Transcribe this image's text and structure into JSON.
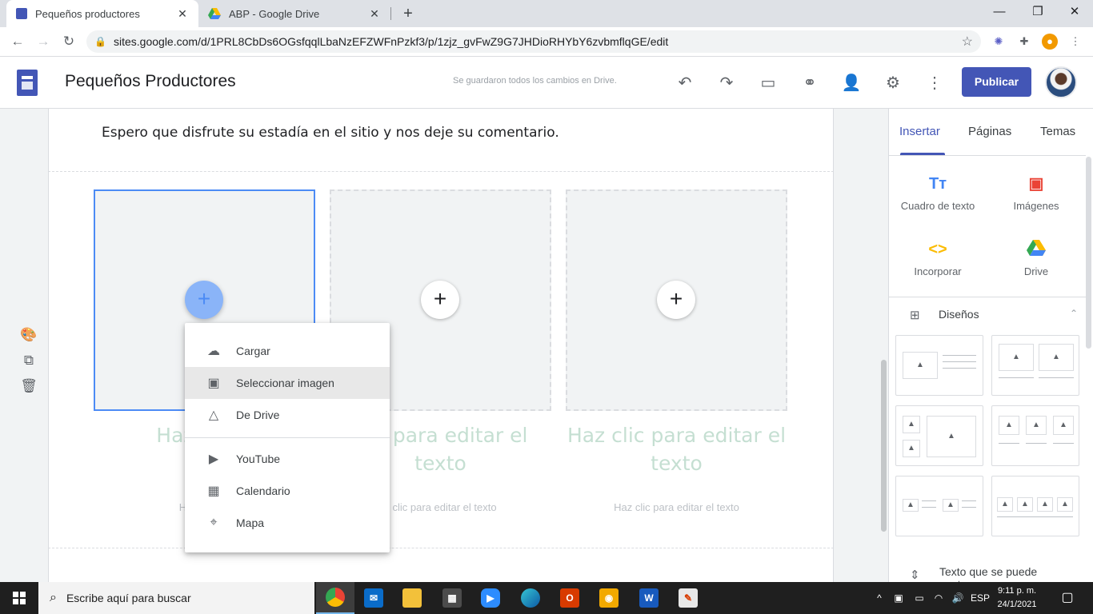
{
  "browser": {
    "tabs": [
      {
        "title": "Pequeños productores",
        "active": true
      },
      {
        "title": "ABP - Google Drive",
        "active": false
      }
    ],
    "url": "sites.google.com/d/1PRL8CbDs6OGsfqqlLbaNzEFZWFnPzkf3/p/1zjz_gvFwZ9G7JHDioRHYbY6zvbmflqGE/edit"
  },
  "header": {
    "site_title": "Pequeños Productores",
    "save_status": "Se guardaron todos los cambios en Drive.",
    "publish_label": "Publicar"
  },
  "page": {
    "intro_text": "Espero que disfrute su estadía en el sitio y nos deje su comentario.",
    "columns": [
      {
        "caption_title_lines": [
          "Haz clic p",
          "te"
        ],
        "caption_sub": "Haz clic pa",
        "selected": true
      },
      {
        "caption_title_lines": [
          "clic para editar el",
          "texto"
        ],
        "caption_sub": "z clic para editar el texto",
        "selected": false
      },
      {
        "caption_title_lines": [
          "Haz clic para editar el",
          "texto"
        ],
        "caption_sub": "Haz clic para editar el texto",
        "selected": false
      }
    ]
  },
  "image_menu": {
    "items": [
      {
        "label": "Cargar",
        "icon": "upload-cloud-icon"
      },
      {
        "label": "Seleccionar imagen",
        "icon": "image-icon",
        "hover": true
      },
      {
        "label": "De Drive",
        "icon": "drive-icon"
      },
      {
        "label": "YouTube",
        "icon": "youtube-icon"
      },
      {
        "label": "Calendario",
        "icon": "calendar-icon"
      },
      {
        "label": "Mapa",
        "icon": "map-pin-icon"
      }
    ]
  },
  "right_panel": {
    "tabs": [
      "Insertar",
      "Páginas",
      "Temas"
    ],
    "active_tab": "Insertar",
    "insert_items": [
      {
        "label": "Cuadro de texto",
        "icon": "text-box-icon",
        "color": "#4285f4"
      },
      {
        "label": "Imágenes",
        "icon": "image-icon",
        "color": "#ea4335"
      },
      {
        "label": "Incorporar",
        "icon": "embed-code-icon",
        "color": "#fbbc04"
      },
      {
        "label": "Drive",
        "icon": "drive-icon",
        "color": "#34a853"
      }
    ],
    "designs_label": "Diseños",
    "bottom_label": "Texto que se puede contraer"
  },
  "taskbar": {
    "search_placeholder": "Escribe aquí para buscar",
    "language": "ESP",
    "time": "9:11 p. m.",
    "date": "24/1/2021"
  },
  "colors": {
    "brand": "#4356b6",
    "selection": "#4c8bf5",
    "caption": "#c5dfd2"
  }
}
